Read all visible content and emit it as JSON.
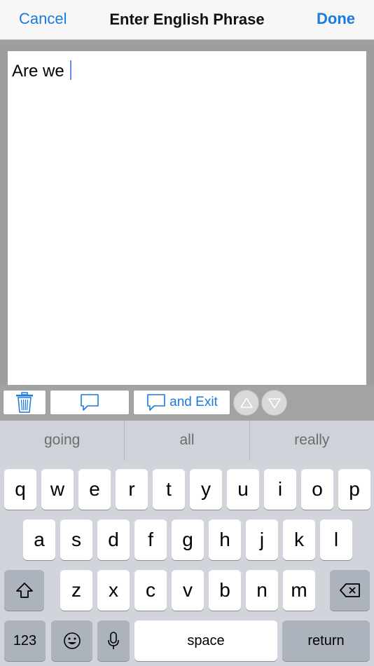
{
  "nav": {
    "cancel": "Cancel",
    "title": "Enter English Phrase",
    "done": "Done"
  },
  "editor": {
    "text": "Are we"
  },
  "toolbar": {
    "exit_label": "and Exit"
  },
  "suggestions": [
    "going",
    "all",
    "really"
  ],
  "keyboard": {
    "row1": [
      "q",
      "w",
      "e",
      "r",
      "t",
      "y",
      "u",
      "i",
      "o",
      "p"
    ],
    "row2": [
      "a",
      "s",
      "d",
      "f",
      "g",
      "h",
      "j",
      "k",
      "l"
    ],
    "row3": [
      "z",
      "x",
      "c",
      "v",
      "b",
      "n",
      "m"
    ],
    "numbers": "123",
    "space": "space",
    "return": "return"
  },
  "colors": {
    "accent": "#1a7ae0",
    "caret": "#6d8fe6"
  }
}
